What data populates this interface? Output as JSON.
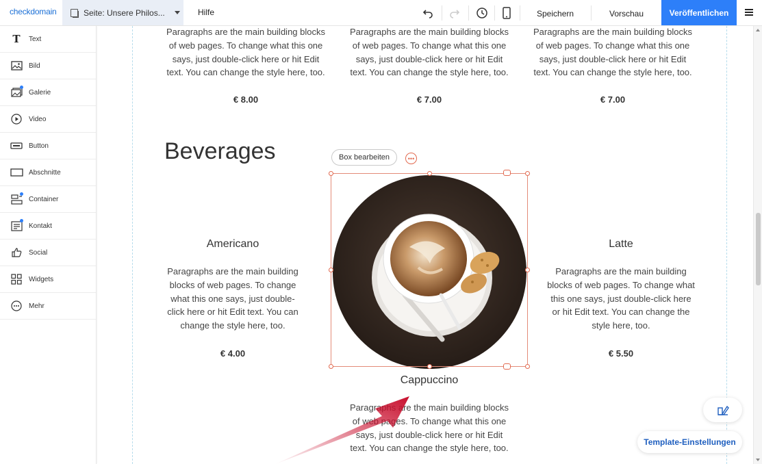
{
  "topbar": {
    "logo": "checkdomain",
    "page_select": "Seite: Unsere Philos...",
    "help": "Hilfe",
    "save": "Speichern",
    "preview": "Vorschau",
    "publish": "Veröffentlichen",
    "icons": [
      "undo-icon",
      "redo-icon",
      "history-icon",
      "mobile-view-icon",
      "menu-icon"
    ]
  },
  "sidebar": {
    "items": [
      {
        "label": "Text",
        "icon": "text-icon",
        "badge": false
      },
      {
        "label": "Bild",
        "icon": "image-icon",
        "badge": false
      },
      {
        "label": "Galerie",
        "icon": "gallery-icon",
        "badge": true
      },
      {
        "label": "Video",
        "icon": "video-icon",
        "badge": false
      },
      {
        "label": "Button",
        "icon": "button-icon",
        "badge": false
      },
      {
        "label": "Abschnitte",
        "icon": "section-icon",
        "badge": false
      },
      {
        "label": "Container",
        "icon": "container-icon",
        "badge": true
      },
      {
        "label": "Kontakt",
        "icon": "contact-icon",
        "badge": true
      },
      {
        "label": "Social",
        "icon": "social-icon",
        "badge": false
      },
      {
        "label": "Widgets",
        "icon": "widgets-icon",
        "badge": false
      },
      {
        "label": "Mehr",
        "icon": "more-icon",
        "badge": false
      }
    ]
  },
  "content": {
    "top_items": [
      {
        "text": "Paragraphs are the main building blocks of web pages. To change what this one says, just double-click here or hit Edit text. You can change the style here, too.",
        "price": "€ 8.00"
      },
      {
        "text": "Paragraphs are the main building blocks of web pages. To change what this one says, just double-click here or hit Edit text. You can change the style here, too.",
        "price": "€ 7.00"
      },
      {
        "text": "Paragraphs are the main building blocks of web pages. To change what this one says, just double-click here or hit Edit text. You can change the style here, too.",
        "price": "€ 7.00"
      }
    ],
    "section_title": "Beverages",
    "box_edit": "Box bearbeiten",
    "beverages": [
      {
        "name": "Americano",
        "text": "Paragraphs are the main building blocks of web pages. To change what this one says, just double-click here or hit Edit text. You can change the style here, too.",
        "price": "€ 4.00"
      },
      {
        "name": "Cappuccino",
        "text": "Paragraphs are the main building blocks of web pages. To change what this one says, just double-click here or hit Edit text. You can change the style here, too.",
        "price": ""
      },
      {
        "name": "Latte",
        "text": "Paragraphs are the main building blocks of web pages. To change what this one says, just double-click here or hit Edit text. You can change the style here, too.",
        "price": "€ 5.50"
      }
    ]
  },
  "floating": {
    "template_settings": "Template-Einstellungen",
    "design_icon": "design-edit-icon"
  },
  "colors": {
    "accent": "#2d7ff9",
    "selection": "#e26a50",
    "arrow": "#c8102e"
  }
}
